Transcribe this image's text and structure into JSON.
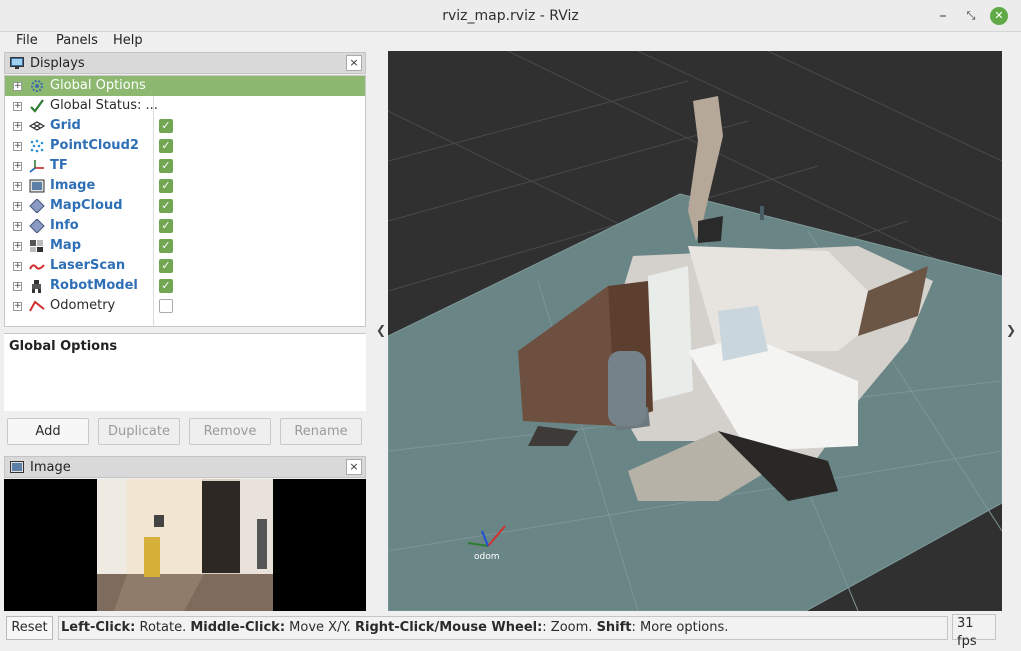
{
  "window": {
    "title": "rviz_map.rviz - RViz",
    "minimize": "–",
    "maximize": "⤡",
    "close": "✕"
  },
  "menu": {
    "file": "File",
    "panels": "Panels",
    "help": "Help"
  },
  "displays_panel": {
    "title": "Displays",
    "close": "×",
    "items": [
      {
        "label": "Global Options",
        "icon": "gear-icon",
        "checked": null,
        "selected": true
      },
      {
        "label": "Global Status: ...",
        "icon": "checkmark-icon",
        "checked": null
      },
      {
        "label": "Grid",
        "icon": "grid-icon",
        "checked": true
      },
      {
        "label": "PointCloud2",
        "icon": "pointcloud-icon",
        "checked": true
      },
      {
        "label": "TF",
        "icon": "tf-axes-icon",
        "checked": true
      },
      {
        "label": "Image",
        "icon": "image-icon",
        "checked": true
      },
      {
        "label": "MapCloud",
        "icon": "diamond-icon",
        "checked": true
      },
      {
        "label": "Info",
        "icon": "diamond-icon",
        "checked": true
      },
      {
        "label": "Map",
        "icon": "map-icon",
        "checked": true
      },
      {
        "label": "LaserScan",
        "icon": "laserscan-icon",
        "checked": true
      },
      {
        "label": "RobotModel",
        "icon": "robot-icon",
        "checked": true
      },
      {
        "label": "Odometry",
        "icon": "odometry-icon",
        "checked": false
      }
    ],
    "description_title": "Global Options",
    "buttons": {
      "add": "Add",
      "duplicate": "Duplicate",
      "remove": "Remove",
      "rename": "Rename"
    }
  },
  "image_panel": {
    "title": "Image",
    "close": "×"
  },
  "viewport": {
    "frame_label": "odom",
    "left_arrow": "❮",
    "right_arrow": "❯"
  },
  "statusbar": {
    "reset": "Reset",
    "hint": [
      {
        "bold": "Left-Click:",
        "text": " Rotate. "
      },
      {
        "bold": "Middle-Click:",
        "text": " Move X/Y. "
      },
      {
        "bold": "Right-Click/Mouse Wheel:",
        "text": ": Zoom. "
      },
      {
        "bold": "Shift",
        "text": ": More options."
      }
    ],
    "fps": "31 fps"
  },
  "colors": {
    "selected_row": "#8cb96f",
    "checkbox": "#72a653",
    "link_blue": "#2e6fb5",
    "viewport_bg": "#303030",
    "grid_plane": "#6a8586"
  }
}
